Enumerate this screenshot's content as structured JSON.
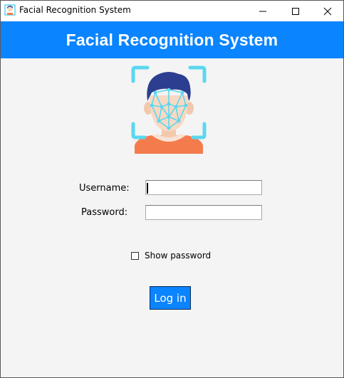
{
  "window": {
    "title": "Facial Recognition System",
    "controls": {
      "minimize": "minimize-icon",
      "maximize": "maximize-icon",
      "close": "close-icon"
    }
  },
  "header": {
    "title": "Facial Recognition System",
    "background": "#0a84ff"
  },
  "form": {
    "username_label": "Username:",
    "username_value": "",
    "password_label": "Password:",
    "password_value": "",
    "show_password_label": "Show password",
    "show_password_checked": false,
    "login_label": "Log in"
  },
  "colors": {
    "accent": "#0a84ff",
    "face_scan": "#5bd7f0",
    "hair": "#2c3e8f",
    "shirt": "#f47c4c"
  }
}
